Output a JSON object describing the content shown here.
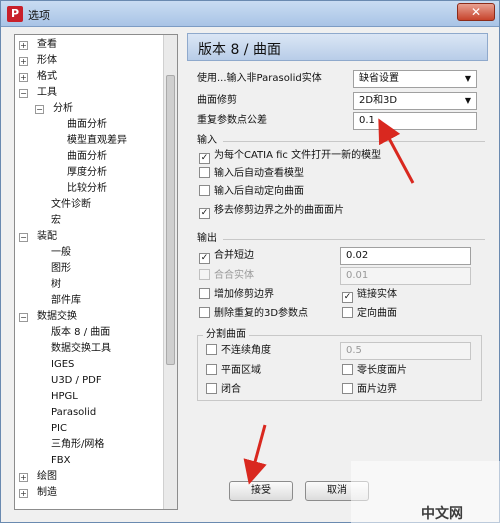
{
  "window": {
    "title": "选项",
    "app_icon": "P"
  },
  "tree": {
    "items": [
      {
        "label": "查看",
        "expander": "+"
      },
      {
        "label": "形体",
        "expander": "+"
      },
      {
        "label": "格式",
        "expander": "+"
      },
      {
        "label": "工具",
        "expander": "−"
      },
      {
        "label": "分析",
        "expander": "−"
      },
      {
        "label": "曲面分析"
      },
      {
        "label": "模型直观差异"
      },
      {
        "label": "曲面分析"
      },
      {
        "label": "厚度分析"
      },
      {
        "label": "比较分析"
      },
      {
        "label": "文件诊断"
      },
      {
        "label": "宏"
      },
      {
        "label": "装配",
        "expander": "−"
      },
      {
        "label": "一般"
      },
      {
        "label": "图形"
      },
      {
        "label": "树"
      },
      {
        "label": "部件库"
      },
      {
        "label": "数据交换",
        "expander": "−"
      },
      {
        "label": "版本 8 / 曲面"
      },
      {
        "label": "数据交换工具"
      },
      {
        "label": "IGES"
      },
      {
        "label": "U3D / PDF"
      },
      {
        "label": "HPGL"
      },
      {
        "label": "Parasolid"
      },
      {
        "label": "PIC"
      },
      {
        "label": "三角形/网格"
      },
      {
        "label": "FBX"
      },
      {
        "label": "绘图",
        "expander": "+"
      },
      {
        "label": "制造",
        "expander": "+"
      }
    ]
  },
  "panel": {
    "title": "版本 8 / 曲面",
    "import_parasolid_label": "使用...输入非Parasolid实体",
    "import_parasolid_value": "缺省设置",
    "surface_trim_label": "曲面修剪",
    "surface_trim_value": "2D和3D",
    "duplicate_tol_label": "重复参数点公差",
    "duplicate_tol_value": "0.1",
    "input_section": "输入",
    "cb_new_model": "为每个CATIA fic 文件打开一新的模型",
    "cb_auto_check": "输入后自动查看模型",
    "cb_auto_orient": "输入后自动定向曲面",
    "cb_remove_faces": "移去修剪边界之外的曲面面片",
    "output_section": "输出",
    "cb_merge_edges": "合并短边",
    "merge_edges_value": "0.02",
    "cb_merge_solids": "合合实体",
    "merge_solids_value": "0.01",
    "cb_add_trim": "增加修剪边界",
    "cb_link_solid": "链接实体",
    "cb_delete_dup": "删除重复的3D参数点",
    "cb_orient_surface": "定向曲面",
    "split_section": "分割曲面",
    "cb_discontinuous": "不连续角度",
    "discontinuous_value": "0.5",
    "cb_plane_region": "平面区域",
    "cb_zero_length": "零长度面片",
    "cb_closed": "闭合",
    "cb_face_boundary": "面片边界"
  },
  "buttons": {
    "ok": "接受",
    "cancel": "取消"
  },
  "watermark": "中文网"
}
